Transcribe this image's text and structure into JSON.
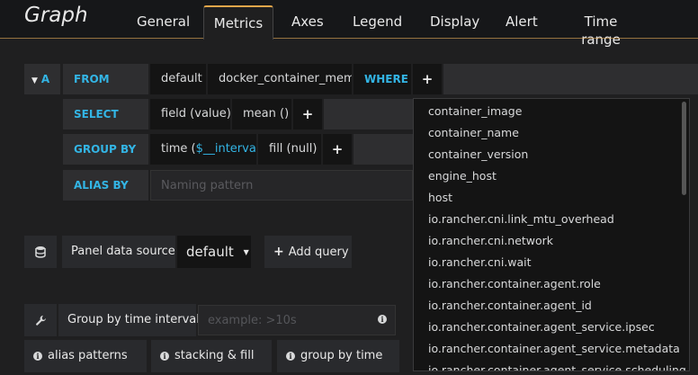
{
  "header": {
    "title": "Graph",
    "tabs": [
      "General",
      "Metrics",
      "Axes",
      "Legend",
      "Display",
      "Alert",
      "Time range"
    ],
    "active_tab": "Metrics"
  },
  "query": {
    "ref_id": "A",
    "from_label": "FROM",
    "policy": "default",
    "measurement": "docker_container_mem",
    "where_label": "WHERE",
    "select_label": "SELECT",
    "select_field": "field (value)",
    "select_fn": "mean ()",
    "group_by_label": "GROUP BY",
    "group_time_prefix": "time (",
    "group_time_var": "$__interval",
    "group_time_suffix": ")",
    "group_fill": "fill (null)",
    "alias_label": "ALIAS BY",
    "alias_placeholder": "Naming pattern",
    "plus": "+"
  },
  "datasource": {
    "label": "Panel data source",
    "value": "default",
    "add_query": "Add query"
  },
  "options": {
    "interval_label": "Group by time interval",
    "interval_placeholder": "example: >10s",
    "help_alias": "alias patterns",
    "help_stacking": "stacking & fill",
    "help_group": "group by time"
  },
  "dropdown_items": [
    "container_image",
    "container_name",
    "container_version",
    "engine_host",
    "host",
    "io.rancher.cni.link_mtu_overhead",
    "io.rancher.cni.network",
    "io.rancher.cni.wait",
    "io.rancher.container.agent.role",
    "io.rancher.container.agent_id",
    "io.rancher.container.agent_service.ipsec",
    "io.rancher.container.agent_service.metadata",
    "io.rancher.container.agent_service.scheduling"
  ],
  "colors": {
    "accent": "#e3a64a",
    "keyword": "#33b5e5",
    "background": "#1f1f20"
  }
}
